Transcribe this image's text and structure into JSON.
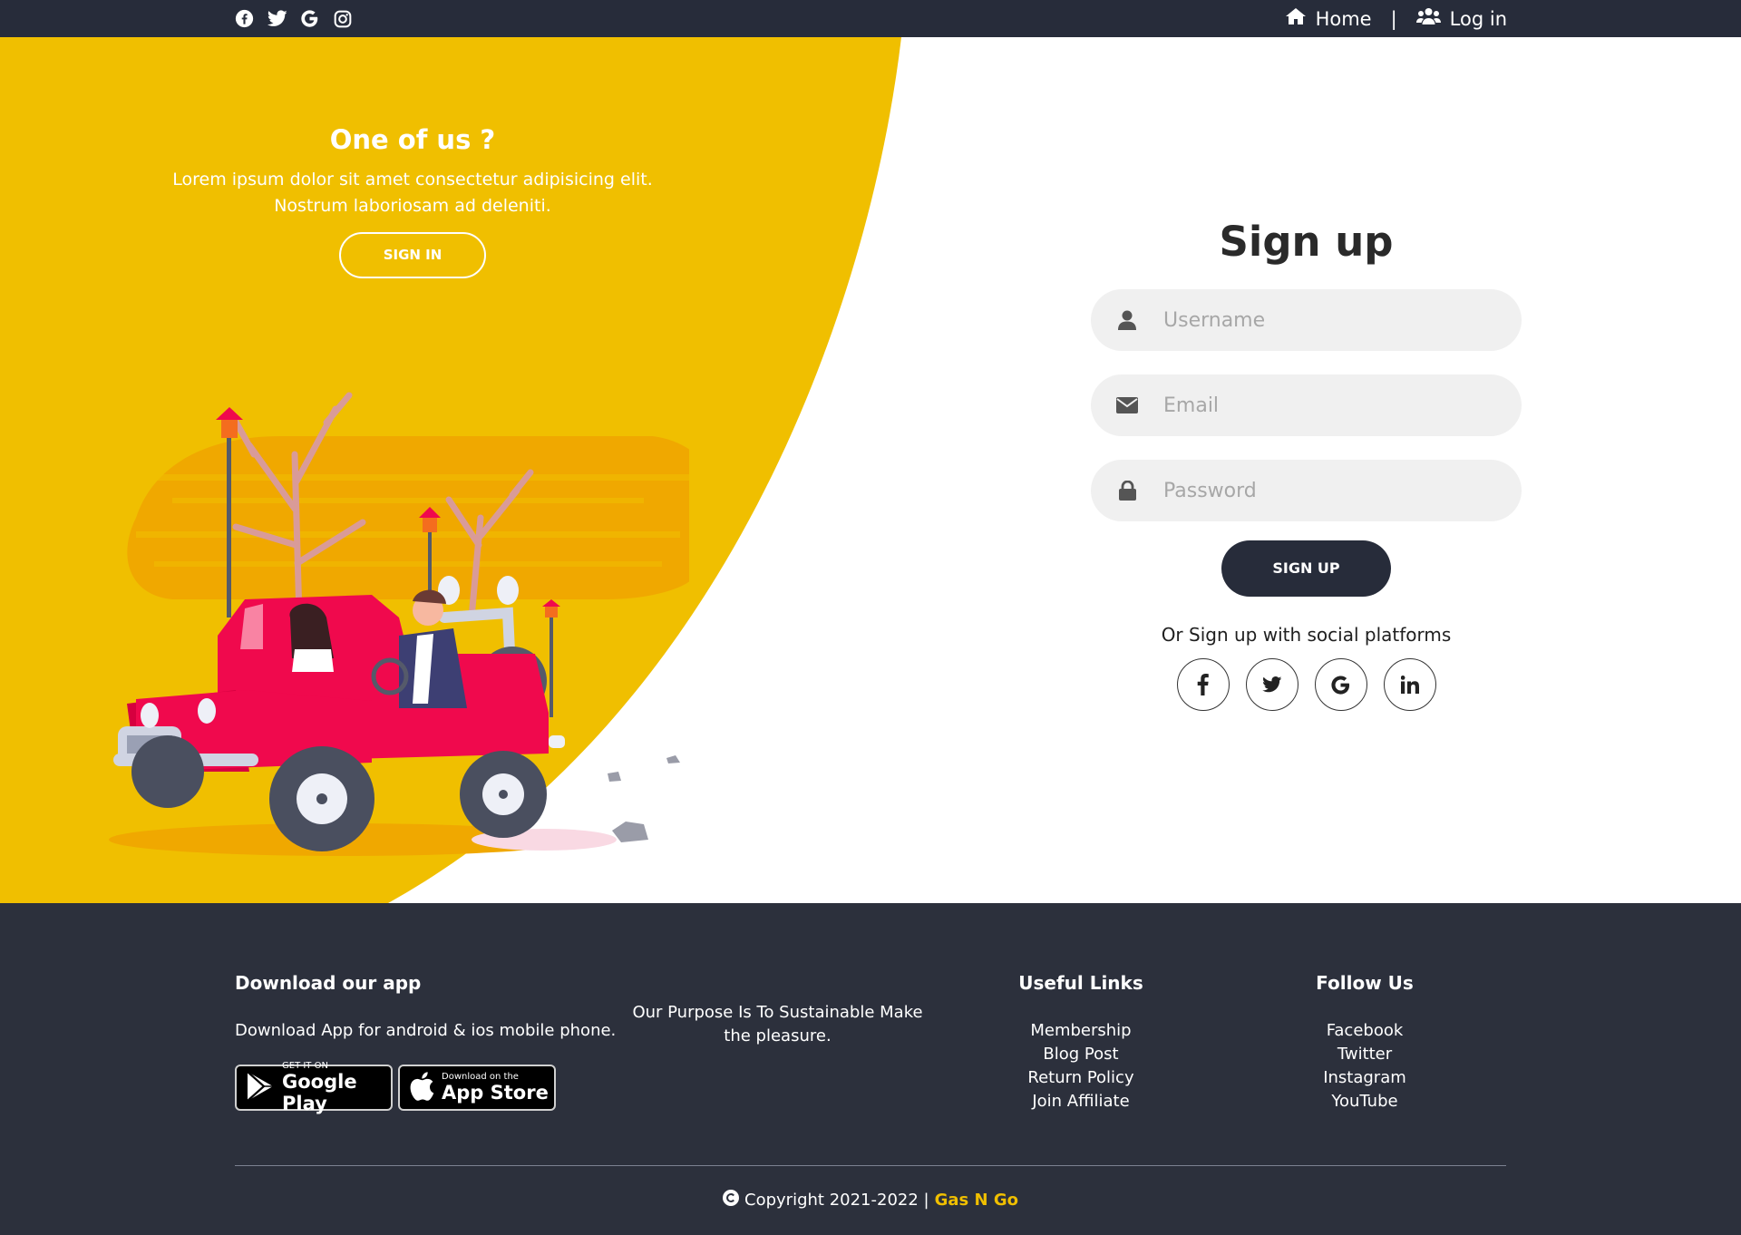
{
  "colors": {
    "accent": "#f0bf00",
    "dark": "#272c3a",
    "footer": "#2c303c",
    "jeep": "#f0094d"
  },
  "topbar": {
    "social_icons": [
      "facebook-icon",
      "twitter-icon",
      "google-icon",
      "instagram-icon"
    ],
    "nav": {
      "home": "Home",
      "separator": "|",
      "login": "Log in"
    }
  },
  "left_panel": {
    "title": "One of us ?",
    "text": "Lorem ipsum dolor sit amet consectetur adipisicing elit. Nostrum laboriosam ad deleniti.",
    "button": "SIGN IN"
  },
  "signup": {
    "title": "Sign up",
    "username_placeholder": "Username",
    "email_placeholder": "Email",
    "password_placeholder": "Password",
    "button": "SIGN UP",
    "social_text": "Or Sign up with social platforms",
    "social_icons": [
      "facebook-icon",
      "twitter-icon",
      "google-icon",
      "linkedin-icon"
    ]
  },
  "footer": {
    "app": {
      "title": "Download our app",
      "text": "Download App for android & ios mobile phone.",
      "google_small": "GET IT ON",
      "google_big": "Google Play",
      "apple_small": "Download on the",
      "apple_big": "App Store"
    },
    "purpose": "Our Purpose Is To Sustainable Make the pleasure.",
    "useful_links": {
      "title": "Useful Links",
      "items": [
        "Membership",
        "Blog Post",
        "Return Policy",
        "Join Affiliate"
      ]
    },
    "follow_us": {
      "title": "Follow Us",
      "items": [
        "Facebook",
        "Twitter",
        "Instagram",
        "YouTube"
      ]
    },
    "copyright": "Copyright 2021-2022 |",
    "brand": "Gas N Go"
  }
}
